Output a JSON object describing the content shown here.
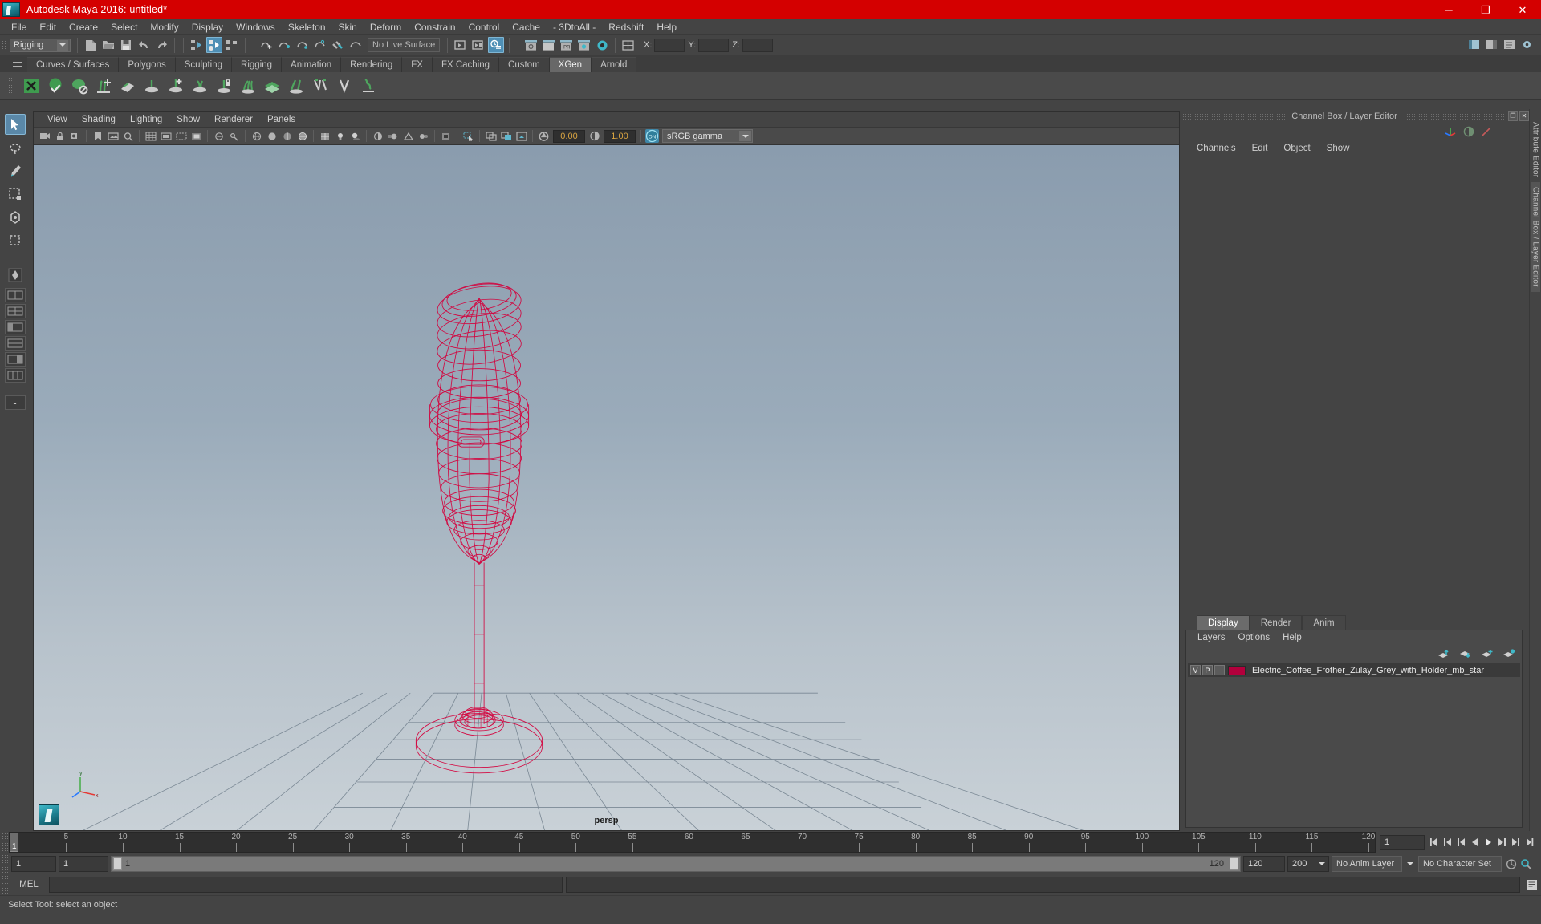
{
  "window": {
    "title": "Autodesk Maya 2016: untitled*",
    "logo_icon": "maya-logo-icon",
    "minimize_label": "─",
    "maximize_label": "❐",
    "close_label": "✕",
    "titlebar_color": "#d40000"
  },
  "menubar": {
    "items": [
      "File",
      "Edit",
      "Create",
      "Select",
      "Modify",
      "Display",
      "Windows",
      "Skeleton",
      "Skin",
      "Deform",
      "Constrain",
      "Control",
      "Cache",
      "- 3DtoAll -",
      "Redshift",
      "Help"
    ]
  },
  "statusline": {
    "menu_set": "Rigging",
    "live_surface": "No Live Surface",
    "coord_x_label": "X:",
    "coord_y_label": "Y:",
    "coord_z_label": "Z:",
    "coord_x_value": "",
    "coord_y_value": "",
    "coord_z_value": "",
    "icons": [
      "new-scene-icon",
      "open-scene-icon",
      "save-scene-icon",
      "undo-icon",
      "redo-icon",
      "select-by-hierarchy-icon",
      "select-by-object-icon",
      "select-by-component-icon",
      "snap-to-grid-icon",
      "snap-to-curve-icon",
      "snap-to-point-icon",
      "snap-to-projected-center-icon",
      "snap-to-view-plane-icon",
      "make-live-icon",
      "show-editor-icon",
      "open-outliner-icon",
      "open-hypergraph-icon",
      "render-view-icon",
      "render-current-frame-icon",
      "ipr-render-icon",
      "render-settings-icon",
      "hypershade-icon",
      "open-render-setup-icon"
    ],
    "right_icons": [
      "sidebar-toggle-icon",
      "channel-box-toggle-icon",
      "attribute-editor-toggle-icon",
      "tool-settings-toggle-icon"
    ]
  },
  "shelf": {
    "tabs": [
      "Curves / Surfaces",
      "Polygons",
      "Sculpting",
      "Rigging",
      "Animation",
      "Rendering",
      "FX",
      "FX Caching",
      "Custom",
      "XGen",
      "Arnold"
    ],
    "active_tab": "XGen",
    "icons": [
      "xgen-description-icon",
      "xgen-sphere-icon",
      "xgen-patch-icon",
      "xgen-add-groom-icon",
      "xgen-groomable-splines-icon",
      "xgen-place-icon",
      "xgen-add-icon",
      "xgen-density-icon",
      "xgen-lock-icon",
      "xgen-clump-icon",
      "xgen-layer-icon",
      "xgen-noise-icon",
      "xgen-cut-icon",
      "xgen-part-icon",
      "xgen-coil-icon"
    ]
  },
  "toolbox": {
    "items": [
      "select-tool-icon",
      "lasso-select-tool-icon",
      "paint-select-tool-icon",
      "move-tool-icon",
      "rotate-tool-icon",
      "scale-tool-icon",
      "last-tool-icon",
      "show-manipulator-tool-icon"
    ],
    "layout_icons": [
      "single-perspective-view-icon",
      "four-view-layout-icon",
      "persp-outliner-layout-icon",
      "persp-graph-layout-icon",
      "persp-hypershade-layout-icon",
      "persp-render-layout-icon"
    ]
  },
  "viewport": {
    "menus": [
      "View",
      "Shading",
      "Lighting",
      "Show",
      "Renderer",
      "Panels"
    ],
    "camera_label": "persp",
    "exposure_value": "0.00",
    "gamma_value": "1.00",
    "color_management": "sRGB gamma",
    "color_management_on_label": "ON",
    "toolbar_icons": [
      "select-camera-icon",
      "lock-camera-icon",
      "camera-attributes-icon",
      "bookmark-icon",
      "image-plane-icon",
      "two-d-pan-zoom-icon",
      "grid-toggle-icon",
      "film-gate-icon",
      "resolution-gate-icon",
      "gate-mask-icon",
      "xray-toggle-icon",
      "xray-joints-icon",
      "wireframe-shading-icon",
      "smooth-shade-all-icon",
      "flat-shade-icon",
      "shaded-wireframe-icon",
      "textured-icon",
      "use-all-lights-icon",
      "shadows-icon",
      "screen-space-ao-icon",
      "motion-blur-icon",
      "multisample-aa-icon",
      "depth-of-field-icon",
      "isolate-select-icon",
      "display-overrides-icon",
      "exposure-icon",
      "gamma-icon"
    ],
    "object_name": "Electric_Coffee_Frother_Zulay_Grey_with_Holder",
    "wireframe_color": "#d4003c"
  },
  "right_panel": {
    "title": "Channel Box / Layer Editor",
    "restore_label": "❐",
    "close_label": "✕",
    "icons": [
      "move-axis-icon",
      "channel-contrast-icon",
      "anim-curve-icon"
    ],
    "menus": [
      "Channels",
      "Edit",
      "Object",
      "Show"
    ],
    "vertical_tabs": [
      "Attribute Editor",
      "Channel Box / Layer Editor"
    ]
  },
  "layer_editor": {
    "tabs": [
      "Display",
      "Render",
      "Anim"
    ],
    "active_tab": "Display",
    "menus": [
      "Layers",
      "Options",
      "Help"
    ],
    "icons": [
      "move-layer-up-icon",
      "move-layer-down-icon",
      "new-layer-icon",
      "new-layer-from-selected-icon"
    ],
    "layers": [
      {
        "visibility": "V",
        "playback": "P",
        "reference": "",
        "color": "#b3003c",
        "name": "Electric_Coffee_Frother_Zulay_Grey_with_Holder_mb_star"
      }
    ]
  },
  "timeline": {
    "current_frame": "1",
    "ticks": [
      5,
      10,
      15,
      20,
      25,
      30,
      35,
      40,
      45,
      50,
      55,
      60,
      65,
      70,
      75,
      80,
      85,
      90,
      95,
      100,
      105,
      110,
      115,
      120
    ],
    "start": 1,
    "end": 120,
    "frame_field": "1",
    "playback_icons": [
      "go-to-start-icon",
      "step-back-key-icon",
      "step-back-frame-icon",
      "play-backward-icon",
      "play-forward-icon",
      "step-forward-frame-icon",
      "step-forward-key-icon",
      "go-to-end-icon"
    ]
  },
  "range": {
    "anim_start": "1",
    "range_start": "1",
    "slider_start_label": "1",
    "slider_end_label": "120",
    "range_end": "120",
    "anim_end": "200",
    "anim_layer": "No Anim Layer",
    "character_set": "No Character Set",
    "auto_key_icon": "auto-keyframe-icon",
    "anim_prefs_icon": "animation-preferences-icon"
  },
  "command_line": {
    "label": "MEL",
    "input_value": "",
    "output_value": "",
    "script_editor_icon": "script-editor-icon"
  },
  "statusbar": {
    "text": "Select Tool: select an object"
  }
}
